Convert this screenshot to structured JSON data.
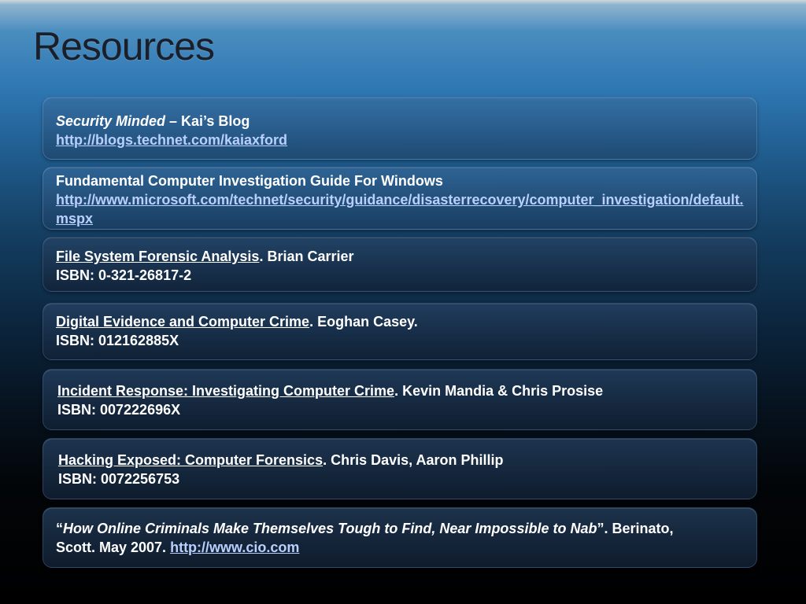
{
  "title": "Resources",
  "items": [
    {
      "title_italic": "Security Minded",
      "title_rest": " – Kai’s Blog",
      "url": "http://blogs.technet.com/kaiaxford"
    },
    {
      "title": "Fundamental Computer Investigation Guide For Windows",
      "url": "http://www.microsoft.com/technet/security/guidance/disasterrecovery/computer_investigation/default.mspx"
    },
    {
      "book_title": "File System Forensic Analysis",
      "author": ". Brian Carrier",
      "isbn": "ISBN: 0-321-26817-2"
    },
    {
      "book_title": "Digital Evidence and Computer Crime",
      "author": ". Eoghan Casey.",
      "isbn": "ISBN: 012162885X"
    },
    {
      "book_title": "Incident Response: Investigating Computer Crime",
      "author": ". Kevin Mandia & Chris Prosise",
      "isbn": "ISBN: 007222696X"
    },
    {
      "book_title": "Hacking Exposed: Computer Forensics",
      "author": ". Chris Davis, Aaron Phillip",
      "isbn": "ISBN: 0072256753"
    },
    {
      "open_quote": "“",
      "article_title": "How Online Criminals Make Themselves Tough to Find, Near Impossible to Nab",
      "close_text": "”. Berinato, Scott. May 2007. ",
      "url": "http://www.cio.com"
    }
  ]
}
